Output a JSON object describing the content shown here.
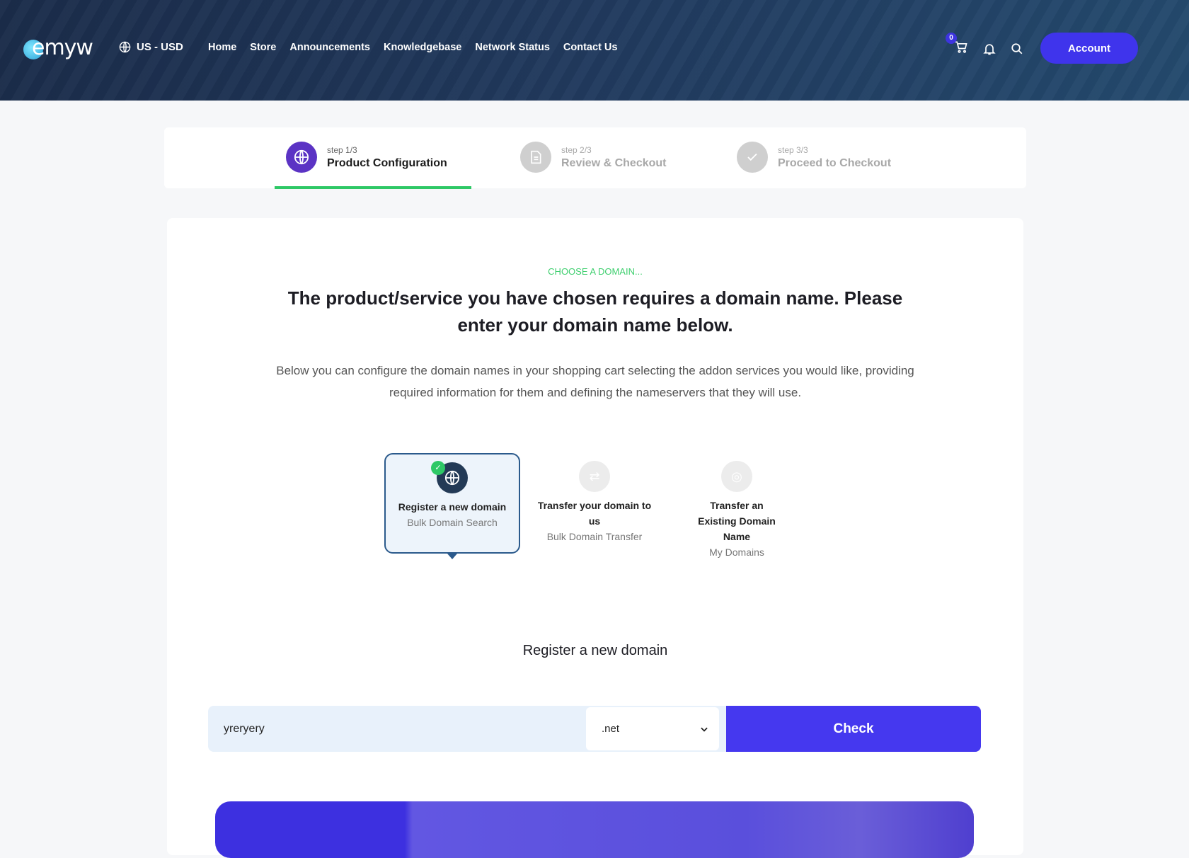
{
  "header": {
    "logo": "emyw",
    "currency": "US - USD",
    "nav": [
      "Home",
      "Store",
      "Announcements",
      "Knowledgebase",
      "Network Status",
      "Contact Us"
    ],
    "cart_count": "0",
    "account_label": "Account"
  },
  "steps": [
    {
      "step": "step 1/3",
      "title": "Product Configuration",
      "icon": "globe-icon",
      "active": true
    },
    {
      "step": "step 2/3",
      "title": "Review & Checkout",
      "icon": "document-icon",
      "active": false
    },
    {
      "step": "step 3/3",
      "title": "Proceed to Checkout",
      "icon": "check-icon",
      "active": false
    }
  ],
  "main": {
    "eyebrow": "CHOOSE A DOMAIN...",
    "heading": "The product/service you have chosen requires a domain name. Please enter your domain name below.",
    "description": "Below you can configure the domain names in your shopping cart selecting the addon services you would like, providing required information for them and defining the nameservers that they will use.",
    "options": [
      {
        "title": "Register a new domain",
        "subtitle": "Bulk Domain Search",
        "selected": true
      },
      {
        "title": "Transfer your domain to us",
        "subtitle": "Bulk Domain Transfer",
        "selected": false
      },
      {
        "title": "Transfer an Existing Domain Name",
        "subtitle": "My Domains",
        "selected": false
      }
    ],
    "register_title": "Register a new domain",
    "domain_value": "yreryery",
    "tld": ".net",
    "check_label": "Check"
  },
  "colors": {
    "accent": "#4538ef",
    "green": "#2ec866",
    "header": "#1f3556"
  }
}
